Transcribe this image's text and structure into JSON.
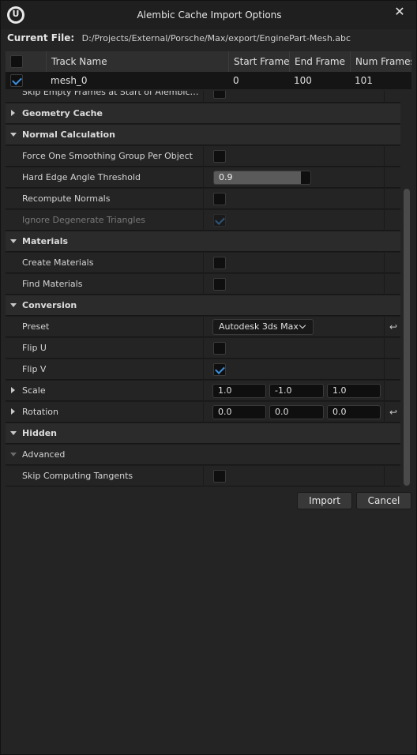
{
  "window": {
    "title": "Alembic Cache Import Options"
  },
  "current_file": {
    "label": "Current File:",
    "path": "D:/Projects/External/Porsche/Max/export/EnginePart-Mesh.abc"
  },
  "track_table": {
    "columns": [
      "Track Name",
      "Start Frame",
      "End Frame",
      "Num Frames"
    ],
    "rows": [
      {
        "checked": true,
        "name": "mesh_0",
        "start": "0",
        "end": "100",
        "num": "101"
      }
    ]
  },
  "properties": {
    "clipped_row": "Skip Empty Frames at Start of Alembic Sequence",
    "geometry_cache": "Geometry Cache",
    "normal_calculation": "Normal Calculation",
    "force_smoothing": "Force One Smoothing Group Per Object",
    "hard_edge": "Hard Edge Angle Threshold",
    "hard_edge_value": "0.9",
    "recompute_normals": "Recompute Normals",
    "ignore_degenerate": "Ignore Degenerate Triangles",
    "materials": "Materials",
    "create_materials": "Create Materials",
    "find_materials": "Find Materials",
    "conversion": "Conversion",
    "preset": "Preset",
    "preset_value": "Autodesk 3ds Max",
    "flip_u": "Flip U",
    "flip_v": "Flip V",
    "scale": "Scale",
    "scale_values": [
      "1.0",
      "-1.0",
      "1.0"
    ],
    "rotation": "Rotation",
    "rotation_values": [
      "0.0",
      "0.0",
      "0.0"
    ],
    "hidden": "Hidden",
    "advanced": "Advanced",
    "skip_tangents": "Skip Computing Tangents"
  },
  "buttons": {
    "import": "Import",
    "cancel": "Cancel"
  },
  "colors": {
    "accent": "#3d8fe0",
    "background": "#242424"
  }
}
